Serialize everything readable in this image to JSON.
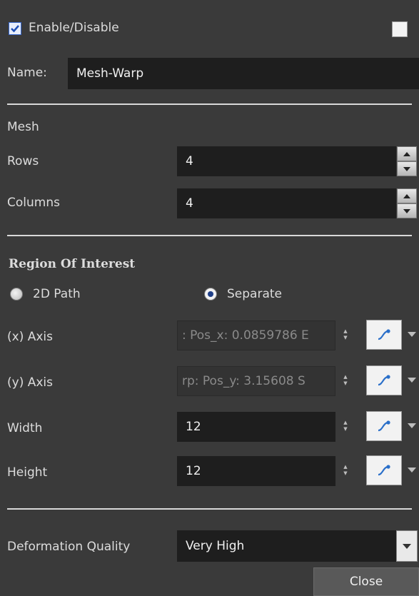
{
  "header": {
    "enable_label": "Enable/Disable",
    "enable_checked": true
  },
  "name": {
    "label": "Name:",
    "value": "Mesh-Warp"
  },
  "mesh": {
    "section_label": "Mesh",
    "rows_label": "Rows",
    "rows_value": "4",
    "columns_label": "Columns",
    "columns_value": "4"
  },
  "roi": {
    "title": "Region Of Interest",
    "option_2d_path": "2D Path",
    "option_separate": "Separate",
    "selected": "Separate",
    "x_axis_label": "(x) Axis",
    "x_axis_value": ": Pos_x: 0.0859786 E",
    "y_axis_label": "(y) Axis",
    "y_axis_value": "rp: Pos_y: 3.15608 S",
    "width_label": "Width",
    "width_value": "12",
    "height_label": "Height",
    "height_value": "12"
  },
  "deformation": {
    "label": "Deformation Quality",
    "value": "Very High"
  },
  "footer": {
    "close_label": "Close"
  },
  "icons": {
    "checkbox": "checkmark-icon",
    "function": "function-curve-icon",
    "spin": "spin-arrows-icon"
  },
  "colors": {
    "background": "#3a3a3a",
    "field": "#1e1e1e",
    "accent": "#3a6ad0"
  }
}
